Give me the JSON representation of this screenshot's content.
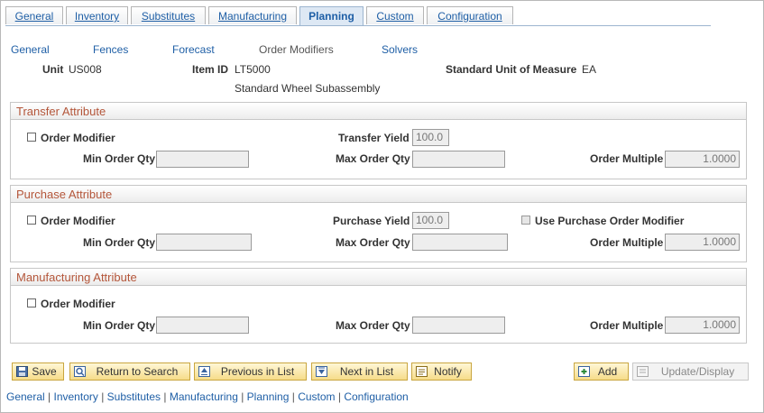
{
  "tabs": [
    "General",
    "Inventory",
    "Substitutes",
    "Manufacturing",
    "Planning",
    "Custom",
    "Configuration"
  ],
  "active_tab": "Planning",
  "sublinks": [
    "General",
    "Fences",
    "Forecast",
    "Order Modifiers",
    "Solvers"
  ],
  "header": {
    "unit_label": "Unit",
    "unit_value": "US008",
    "item_label": "Item ID",
    "item_value": "LT5000",
    "item_desc": "Standard Wheel Subassembly",
    "uom_label": "Standard Unit of Measure",
    "uom_value": "EA"
  },
  "transfer": {
    "title": "Transfer Attribute",
    "order_modifier": "Order Modifier",
    "yield_label": "Transfer Yield",
    "yield_value": "100.0",
    "min_label": "Min Order Qty",
    "max_label": "Max Order Qty",
    "multiple_label": "Order Multiple",
    "multiple_value": "1.0000"
  },
  "purchase": {
    "title": "Purchase Attribute",
    "order_modifier": "Order Modifier",
    "yield_label": "Purchase Yield",
    "yield_value": "100.0",
    "use_po_modifier": "Use Purchase Order Modifier",
    "min_label": "Min Order Qty",
    "max_label": "Max Order Qty",
    "multiple_label": "Order Multiple",
    "multiple_value": "1.0000"
  },
  "manufacturing": {
    "title": "Manufacturing Attribute",
    "order_modifier": "Order Modifier",
    "min_label": "Min Order Qty",
    "max_label": "Max Order Qty",
    "multiple_label": "Order Multiple",
    "multiple_value": "1.0000"
  },
  "toolbar": {
    "save": "Save",
    "return_to_search": "Return to Search",
    "previous_in_list": "Previous in List",
    "next_in_list": "Next in List",
    "notify": "Notify",
    "add": "Add",
    "update_display": "Update/Display"
  },
  "bottom_links": [
    "General",
    "Inventory",
    "Substitutes",
    "Manufacturing",
    "Planning",
    "Custom",
    "Configuration"
  ],
  "colors": {
    "link": "#1f5fa6",
    "group_title": "#b4563a",
    "button": "#f6dc8a"
  }
}
